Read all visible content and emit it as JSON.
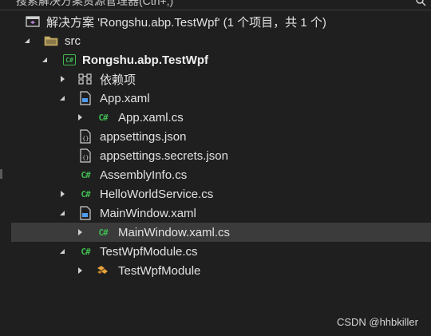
{
  "search": {
    "label": "搜索解决方案资源管理器(Ctrl+;)"
  },
  "solution": {
    "label": "解决方案 'Rongshu.abp.TestWpf' (1 个项目，共 1 个)"
  },
  "tree": [
    {
      "label": "src"
    },
    {
      "label": "Rongshu.abp.TestWpf"
    },
    {
      "label": "依赖项"
    },
    {
      "label": "App.xaml"
    },
    {
      "label": "App.xaml.cs"
    },
    {
      "label": "appsettings.json"
    },
    {
      "label": "appsettings.secrets.json"
    },
    {
      "label": "AssemblyInfo.cs"
    },
    {
      "label": "HelloWorldService.cs"
    },
    {
      "label": "MainWindow.xaml"
    },
    {
      "label": "MainWindow.xaml.cs"
    },
    {
      "label": "TestWpfModule.cs"
    },
    {
      "label": "TestWpfModule"
    }
  ],
  "icons": {
    "cs_file": "C#",
    "cs_project": "C#"
  },
  "watermark": "CSDN @hhbkiller",
  "colors": {
    "background": "#1f1f1f",
    "selection": "#3b3b3b",
    "csharp_green": "#3fb950",
    "folder_yellow": "#c9b16a",
    "vs_purple": "#b180d7"
  }
}
